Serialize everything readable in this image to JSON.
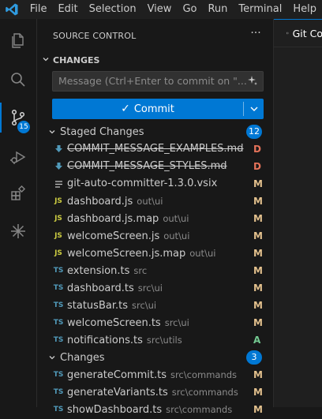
{
  "menu": [
    "File",
    "Edit",
    "Selection",
    "View",
    "Go",
    "Run",
    "Terminal",
    "Help"
  ],
  "activity": [
    {
      "icon": "explorer-icon"
    },
    {
      "icon": "search-icon"
    },
    {
      "icon": "source-control-icon",
      "badge": "15"
    },
    {
      "icon": "run-debug-icon"
    },
    {
      "icon": "extensions-icon"
    },
    {
      "icon": "sparkle-extension-icon"
    }
  ],
  "scm": {
    "title": "SOURCE CONTROL",
    "more": "···",
    "section": "CHANGES",
    "input_placeholder": "Message (Ctrl+Enter to commit on \"...",
    "commit_label": "Commit",
    "groups": [
      {
        "label": "Staged Changes",
        "count": "12",
        "files": [
          {
            "name": "COMMIT_MESSAGE_EXAMPLES.md",
            "dir": "",
            "status": "D",
            "type": "md-download"
          },
          {
            "name": "COMMIT_MESSAGE_STYLES.md",
            "dir": "",
            "status": "D",
            "type": "md-download"
          },
          {
            "name": "git-auto-committer-1.3.0.vsix",
            "dir": "",
            "status": "M",
            "type": "list"
          },
          {
            "name": "dashboard.js",
            "dir": "out\\ui",
            "status": "M",
            "type": "JS"
          },
          {
            "name": "dashboard.js.map",
            "dir": "out\\ui",
            "status": "M",
            "type": "JS"
          },
          {
            "name": "welcomeScreen.js",
            "dir": "out\\ui",
            "status": "M",
            "type": "JS"
          },
          {
            "name": "welcomeScreen.js.map",
            "dir": "out\\ui",
            "status": "M",
            "type": "JS"
          },
          {
            "name": "extension.ts",
            "dir": "src",
            "status": "M",
            "type": "TS"
          },
          {
            "name": "dashboard.ts",
            "dir": "src\\ui",
            "status": "M",
            "type": "TS"
          },
          {
            "name": "statusBar.ts",
            "dir": "src\\ui",
            "status": "M",
            "type": "TS"
          },
          {
            "name": "welcomeScreen.ts",
            "dir": "src\\ui",
            "status": "M",
            "type": "TS"
          },
          {
            "name": "notifications.ts",
            "dir": "src\\utils",
            "status": "A",
            "type": "TS"
          }
        ]
      },
      {
        "label": "Changes",
        "count": "3",
        "files": [
          {
            "name": "generateCommit.ts",
            "dir": "src\\commands",
            "status": "M",
            "type": "TS"
          },
          {
            "name": "generateVariants.ts",
            "dir": "src\\commands",
            "status": "M",
            "type": "TS"
          },
          {
            "name": "showDashboard.ts",
            "dir": "src\\commands",
            "status": "M",
            "type": "TS"
          }
        ]
      }
    ]
  },
  "editor": {
    "tab_label": "Git Co"
  },
  "colors": {
    "accent": "#0078d4",
    "deleted": "#e5735a",
    "modified": "#e2c08d",
    "added": "#73c991",
    "js": "#cbcb41",
    "ts": "#519aba",
    "vscode_logo": "#2f9be0"
  }
}
